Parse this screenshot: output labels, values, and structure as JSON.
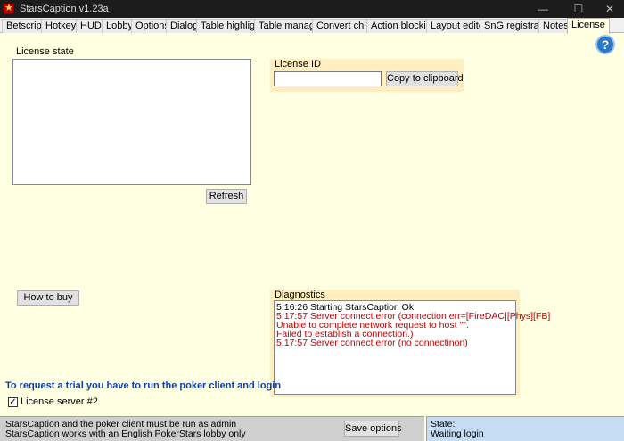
{
  "window": {
    "title": "StarsCaption v1.23a",
    "minimize": "—",
    "maximize": "☐",
    "close": "✕"
  },
  "tabs": [
    {
      "label": "Betscript"
    },
    {
      "label": "Hotkeys"
    },
    {
      "label": "HUD"
    },
    {
      "label": "Lobby"
    },
    {
      "label": "Options"
    },
    {
      "label": "Dialogs"
    },
    {
      "label": "Table highlight"
    },
    {
      "label": "Table manager"
    },
    {
      "label": "Convert chips"
    },
    {
      "label": "Action blocking"
    },
    {
      "label": "Layout editor"
    },
    {
      "label": "SnG registrator"
    },
    {
      "label": "Notes"
    },
    {
      "label": "License"
    }
  ],
  "active_tab": "License",
  "help": {
    "glyph": "?"
  },
  "license_state": {
    "label": "License state",
    "refresh_label": "Refresh"
  },
  "license_id": {
    "label": "License ID",
    "value": "",
    "copy_label": "Copy to clipboard"
  },
  "how_to_buy_label": "How to buy",
  "diagnostics": {
    "label": "Diagnostics",
    "lines": [
      {
        "text": "5:16:26  Starting StarsCaption Ok",
        "color": "#000000"
      },
      {
        "text": "5:17:57  Server connect error (connection err=[FireDAC][Phys][FB]",
        "color": "#c00000"
      },
      {
        "text": "Unable to complete network request to host \"\".",
        "color": "#c00000"
      },
      {
        "text": "Failed to establish a connection.)",
        "color": "#c00000"
      },
      {
        "text": "5:17:57  Server connect error (no connectinon)",
        "color": "#c00000"
      }
    ]
  },
  "trial_notice": "To request a trial you have to run the poker client and login",
  "license_server": {
    "label": "License server #2",
    "checked": true,
    "check_glyph": "✓"
  },
  "status": {
    "line1": "StarsCaption and the poker client must be run as admin",
    "line2": "StarsCaption works with an English PokerStars lobby only",
    "save_label": "Save options",
    "state_label": "State:",
    "state_value": "Waiting login"
  }
}
